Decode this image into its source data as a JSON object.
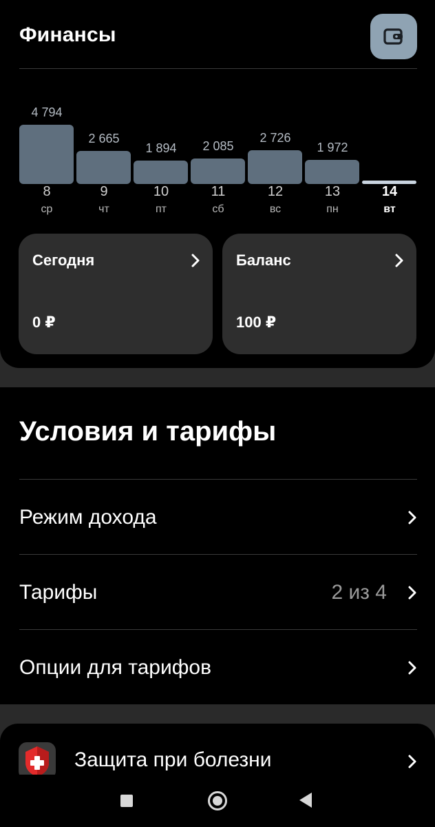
{
  "finance": {
    "title": "Финансы",
    "wallet_icon": "wallet-icon"
  },
  "chart_data": {
    "type": "bar",
    "categories": [
      "8 ср",
      "9 чт",
      "10 пт",
      "11 сб",
      "12 вс",
      "13 пн",
      "14 вт"
    ],
    "days": [
      {
        "num": "8",
        "name": "ср",
        "value": 4794,
        "label": "4 794"
      },
      {
        "num": "9",
        "name": "чт",
        "value": 2665,
        "label": "2 665"
      },
      {
        "num": "10",
        "name": "пт",
        "value": 1894,
        "label": "1 894"
      },
      {
        "num": "11",
        "name": "сб",
        "value": 2085,
        "label": "2 085"
      },
      {
        "num": "12",
        "name": "вс",
        "value": 2726,
        "label": "2 726"
      },
      {
        "num": "13",
        "name": "пн",
        "value": 1972,
        "label": "1 972"
      },
      {
        "num": "14",
        "name": "вт",
        "value": 0,
        "label": "",
        "today": true
      }
    ],
    "values": [
      4794,
      2665,
      1894,
      2085,
      2726,
      1972,
      0
    ]
  },
  "stats": {
    "today": {
      "label": "Сегодня",
      "value": "0 ₽"
    },
    "balance": {
      "label": "Баланс",
      "value": "100 ₽"
    }
  },
  "terms": {
    "title": "Условия и тарифы",
    "rows": [
      {
        "label": "Режим дохода",
        "count": ""
      },
      {
        "label": "Тарифы",
        "count": "2 из 4"
      },
      {
        "label": "Опции для тарифов",
        "count": ""
      }
    ]
  },
  "illness": {
    "label": "Защита при болезни",
    "icon": "medical-shield-icon"
  },
  "colors": {
    "bar": "#5f6f7e",
    "bar_today": "#c9d4e0",
    "wallet_button": "#8fa3b3",
    "card": "#2e2e2e"
  }
}
